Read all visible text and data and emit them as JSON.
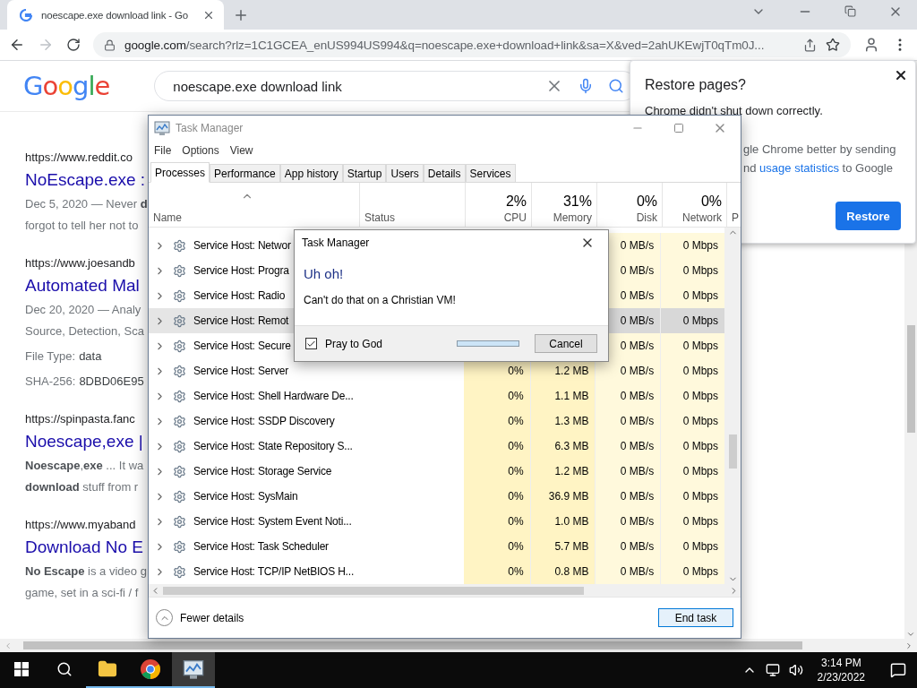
{
  "browser": {
    "tab_title": "noescape.exe download link - Go",
    "url_host": "google.com",
    "url_path": "/search?rlz=1C1GCEA_enUS994US994&q=noescape.exe+download+link&sa=X&ved=2ahUKEwjT0qTm0J..."
  },
  "google": {
    "logo": "Google",
    "query": "noescape.exe download link"
  },
  "results": [
    {
      "url": "https://www.reddit.co",
      "title": "NoEscape.exe :",
      "lines": [
        "Dec 5, 2020 — Never **d**",
        "forgot to tell her not to"
      ]
    },
    {
      "url": "https://www.joesandb",
      "title": "Automated Mal",
      "lines": [
        "Dec 20, 2020 — Analy",
        "Source, Detection, Sca"
      ],
      "meta": [
        {
          "label": "File Type:",
          "value": "data"
        },
        {
          "label": "SHA-256:",
          "value": "8DBD06E95"
        }
      ]
    },
    {
      "url": "https://spinpasta.fanc",
      "title": "Noescape,exe |",
      "lines": [
        "**Noescape**,**exe** ... It wa",
        "**download** stuff from r"
      ]
    },
    {
      "url": "https://www.myaband",
      "title": "Download No E",
      "lines": [
        "**No Escape** is a video g",
        "game, set in a sci-fi / f"
      ]
    }
  ],
  "restore_popup": {
    "title": "Restore pages?",
    "message": "Chrome didn't shut down correctly.",
    "line_1": "gle Chrome better by sending",
    "line_2_start": "nd",
    "link": "usage statistics",
    "line_2_end": "to Google",
    "button": "Restore"
  },
  "task_manager": {
    "title": "Task Manager",
    "menu": [
      "File",
      "Options",
      "View"
    ],
    "tabs": [
      {
        "label": "Processes",
        "selected": true
      },
      {
        "label": "Performance",
        "selected": false
      },
      {
        "label": "App history",
        "selected": false
      },
      {
        "label": "Startup",
        "selected": false
      },
      {
        "label": "Users",
        "selected": false
      },
      {
        "label": "Details",
        "selected": false
      },
      {
        "label": "Services",
        "selected": false
      }
    ],
    "columns": [
      {
        "kind": "name",
        "label": "Name"
      },
      {
        "kind": "status",
        "label": "Status"
      },
      {
        "kind": "metric",
        "value": "2%",
        "label": "CPU"
      },
      {
        "kind": "metric",
        "value": "31%",
        "label": "Memory"
      },
      {
        "kind": "metric",
        "value": "0%",
        "label": "Disk"
      },
      {
        "kind": "metric",
        "value": "0%",
        "label": "Network"
      },
      {
        "kind": "cut",
        "label": "P"
      }
    ],
    "rows": [
      {
        "name": "Service Host: Networ",
        "cpu": "",
        "memory": "",
        "disk": "0 MB/s",
        "network": "0 Mbps",
        "selected": false
      },
      {
        "name": "Service Host: Progra",
        "cpu": "",
        "memory": "",
        "disk": "0 MB/s",
        "network": "0 Mbps",
        "selected": false
      },
      {
        "name": "Service Host: Radio",
        "cpu": "",
        "memory": "",
        "disk": "0 MB/s",
        "network": "0 Mbps",
        "selected": false
      },
      {
        "name": "Service Host: Remot",
        "cpu": "",
        "memory": "",
        "disk": "0 MB/s",
        "network": "0 Mbps",
        "selected": true
      },
      {
        "name": "Service Host: Secure",
        "cpu": "",
        "memory": "",
        "disk": "0 MB/s",
        "network": "0 Mbps",
        "selected": false
      },
      {
        "name": "Service Host: Server",
        "cpu": "0%",
        "memory": "1.2 MB",
        "disk": "0 MB/s",
        "network": "0 Mbps",
        "selected": false
      },
      {
        "name": "Service Host: Shell Hardware De...",
        "cpu": "0%",
        "memory": "1.1 MB",
        "disk": "0 MB/s",
        "network": "0 Mbps",
        "selected": false
      },
      {
        "name": "Service Host: SSDP Discovery",
        "cpu": "0%",
        "memory": "1.3 MB",
        "disk": "0 MB/s",
        "network": "0 Mbps",
        "selected": false
      },
      {
        "name": "Service Host: State Repository S...",
        "cpu": "0%",
        "memory": "6.3 MB",
        "disk": "0 MB/s",
        "network": "0 Mbps",
        "selected": false
      },
      {
        "name": "Service Host: Storage Service",
        "cpu": "0%",
        "memory": "1.2 MB",
        "disk": "0 MB/s",
        "network": "0 Mbps",
        "selected": false
      },
      {
        "name": "Service Host: SysMain",
        "cpu": "0%",
        "memory": "36.9 MB",
        "disk": "0 MB/s",
        "network": "0 Mbps",
        "selected": false
      },
      {
        "name": "Service Host: System Event Noti...",
        "cpu": "0%",
        "memory": "1.0 MB",
        "disk": "0 MB/s",
        "network": "0 Mbps",
        "selected": false
      },
      {
        "name": "Service Host: Task Scheduler",
        "cpu": "0%",
        "memory": "5.7 MB",
        "disk": "0 MB/s",
        "network": "0 Mbps",
        "selected": false
      },
      {
        "name": "Service Host: TCP/IP NetBIOS H...",
        "cpu": "0%",
        "memory": "0.8 MB",
        "disk": "0 MB/s",
        "network": "0 Mbps",
        "selected": false
      }
    ],
    "fewer_details": "Fewer details",
    "end_task": "End task"
  },
  "dialog": {
    "title": "Task Manager",
    "heading": "Uh oh!",
    "message": "Can't do that on a Christian VM!",
    "checkbox": {
      "label": "Pray to God",
      "checked": true
    },
    "progress": {
      "level": 1
    },
    "button": "Cancel"
  },
  "taskbar": {
    "time": "3:14 PM",
    "date": "2/23/2022"
  }
}
